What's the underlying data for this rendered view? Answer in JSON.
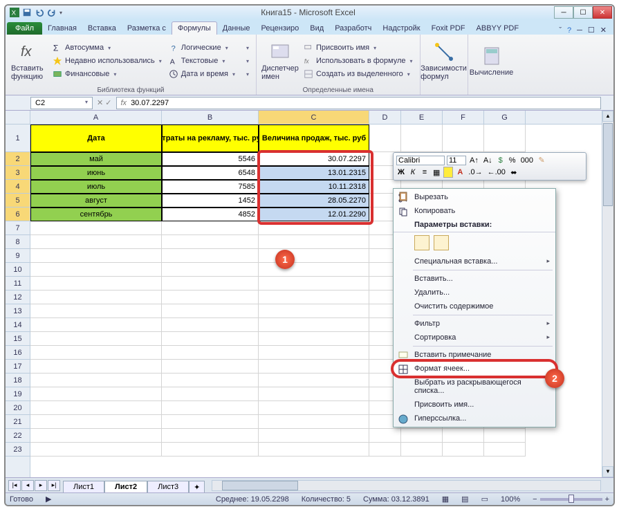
{
  "window": {
    "title": "Книга15 - Microsoft Excel"
  },
  "tabs": {
    "file": "Файл",
    "items": [
      "Главная",
      "Вставка",
      "Разметка с",
      "Формулы",
      "Данные",
      "Рецензиро",
      "Вид",
      "Разработч",
      "Надстройк",
      "Foxit PDF",
      "ABBYY PDF"
    ],
    "active_index": 3
  },
  "ribbon": {
    "insert_fn": "Вставить функцию",
    "lib_items": {
      "autosum": "Автосумма",
      "recent": "Недавно использовались",
      "financial": "Финансовые",
      "logical": "Логические",
      "text": "Текстовые",
      "datetime": "Дата и время"
    },
    "lib_label": "Библиотека функций",
    "name_mgr": "Диспетчер имен",
    "names_items": {
      "define": "Присвоить имя",
      "use": "Использовать в формуле",
      "create": "Создать из выделенного"
    },
    "names_label": "Определенные имена",
    "deps": "Зависимости формул",
    "calc": "Вычисление"
  },
  "namebox": "C2",
  "formula": "30.07.2297",
  "columns": [
    "A",
    "B",
    "C",
    "D",
    "E",
    "F",
    "G"
  ],
  "headers": {
    "a": "Дата",
    "b": "Затраты на рекламу, тыс. руб.",
    "c": "Величина продаж, тыс. руб"
  },
  "data": {
    "months": [
      "май",
      "июнь",
      "июль",
      "август",
      "сентябрь"
    ],
    "b": [
      "5546",
      "6548",
      "7585",
      "1452",
      "4852"
    ],
    "c": [
      "30.07.2297",
      "13.01.2315",
      "10.11.2318",
      "28.05.2270",
      "12.01.2290"
    ]
  },
  "mini_toolbar": {
    "font": "Calibri",
    "size": "11"
  },
  "context_menu": {
    "cut": "Вырезать",
    "copy": "Копировать",
    "paste_label": "Параметры вставки:",
    "paste_special": "Специальная вставка...",
    "insert": "Вставить...",
    "delete": "Удалить...",
    "clear": "Очистить содержимое",
    "filter": "Фильтр",
    "sort": "Сортировка",
    "comment": "Вставить примечание",
    "format": "Формат ячеек...",
    "dropdown": "Выбрать из раскрывающегося списка...",
    "name": "Присвоить имя...",
    "hyperlink": "Гиперссылка..."
  },
  "sheets": {
    "items": [
      "Лист1",
      "Лист2",
      "Лист3"
    ],
    "active_index": 1
  },
  "status": {
    "ready": "Готово",
    "avg": "Среднее: 19.05.2298",
    "count": "Количество: 5",
    "sum": "Сумма: 03.12.3891",
    "zoom": "100%"
  },
  "badges": {
    "one": "1",
    "two": "2"
  }
}
